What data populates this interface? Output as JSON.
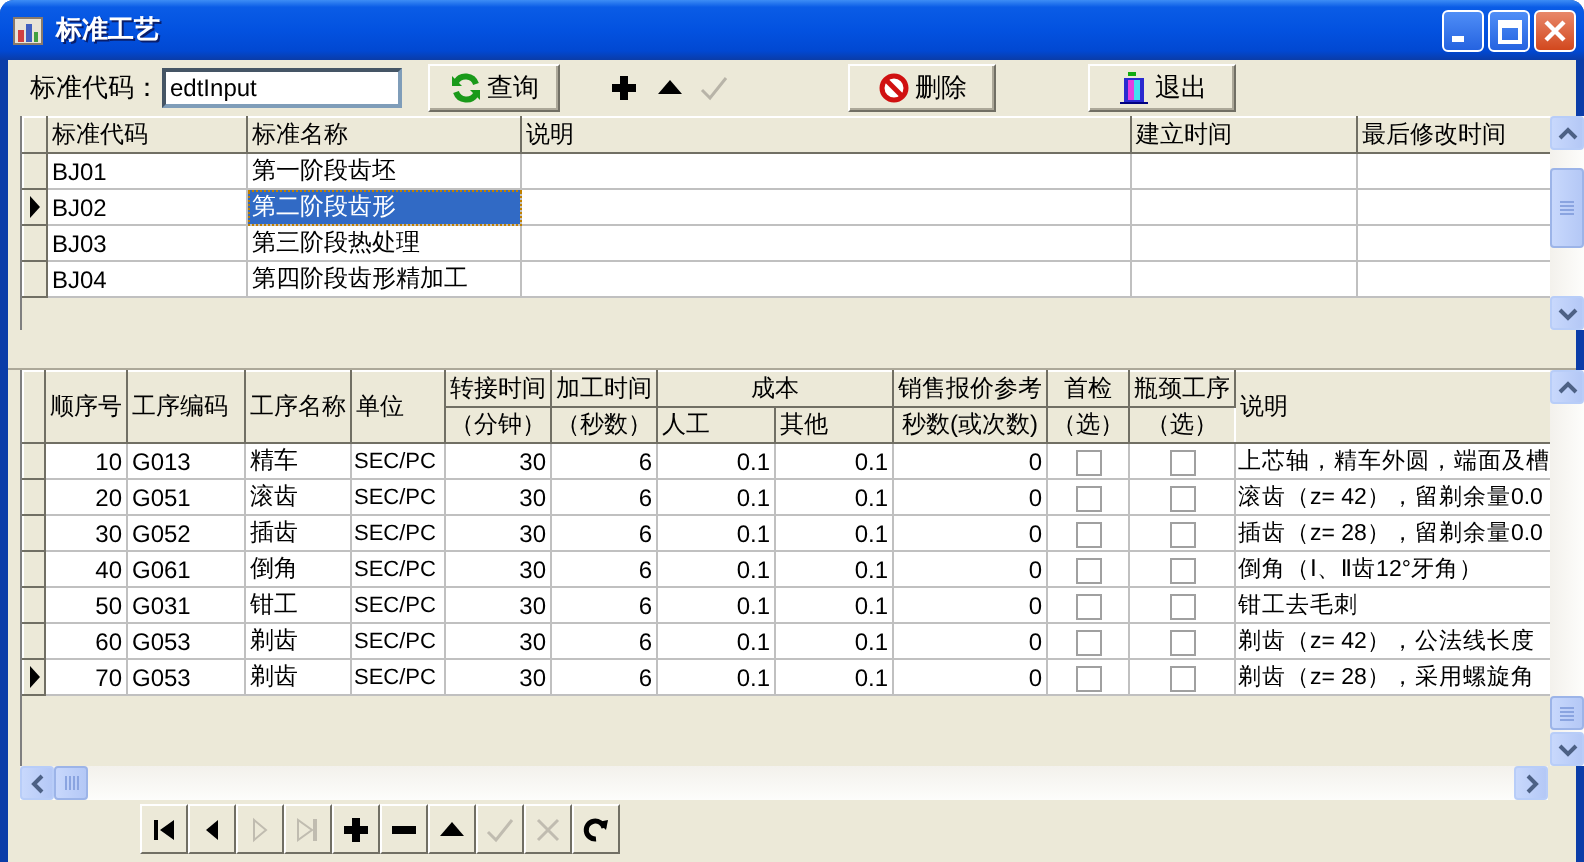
{
  "window": {
    "title": "标准工艺"
  },
  "toolbar": {
    "code_label": "标准代码：",
    "code_input": {
      "value": "edtInput"
    },
    "buttons": [
      {
        "kind": "query",
        "label": "查询",
        "disabled": false
      },
      {
        "kind": "add",
        "disabled": false
      },
      {
        "kind": "edit",
        "disabled": false
      },
      {
        "kind": "post",
        "disabled": true
      },
      {
        "kind": "delete",
        "label": "删除",
        "disabled": false
      },
      {
        "kind": "exit",
        "label": "退出",
        "disabled": false
      }
    ]
  },
  "standards_grid": {
    "columns": [
      "标准代码",
      "标准名称",
      "说明",
      "建立时间",
      "最后修改时间"
    ],
    "rows": [
      {
        "code": "BJ01",
        "name": "第一阶段齿坯",
        "selected": false
      },
      {
        "code": "BJ02",
        "name": "第二阶段齿形",
        "selected": true
      },
      {
        "code": "BJ03",
        "name": "第三阶段热处理",
        "selected": false
      },
      {
        "code": "BJ04",
        "name": "第四阶段齿形精加工",
        "selected": false
      }
    ]
  },
  "process_grid": {
    "columns": [
      {
        "label": "顺序号"
      },
      {
        "label": "工序编码"
      },
      {
        "label": "工序名称"
      },
      {
        "label": "单位"
      },
      {
        "label": "转接时间",
        "sub": "（分钟）"
      },
      {
        "label": "加工时间",
        "sub": "（秒数）"
      },
      {
        "group": "成本",
        "children": [
          "人工",
          "其他"
        ]
      },
      {
        "label": "销售报价参考",
        "sub": "秒数(或次数)"
      },
      {
        "label": "首检",
        "sub": "（选）"
      },
      {
        "label": "瓶颈工序",
        "sub": "（选）"
      },
      {
        "label": "说明"
      }
    ],
    "rows": [
      {
        "seq": "10",
        "code": "G013",
        "name": "精车",
        "unit": "SEC/PC",
        "transfer": "30",
        "process": "6",
        "labor": "0.1",
        "other": "0.1",
        "quote": "0",
        "first_check": false,
        "bottleneck": false,
        "note": "上芯轴，精车外圆，端面及槽",
        "selected": false
      },
      {
        "seq": "20",
        "code": "G051",
        "name": "滚齿",
        "unit": "SEC/PC",
        "transfer": "30",
        "process": "6",
        "labor": "0.1",
        "other": "0.1",
        "quote": "0",
        "first_check": false,
        "bottleneck": false,
        "note": "滚齿（z= 42），留剃余量0.0",
        "selected": false
      },
      {
        "seq": "30",
        "code": "G052",
        "name": "插齿",
        "unit": "SEC/PC",
        "transfer": "30",
        "process": "6",
        "labor": "0.1",
        "other": "0.1",
        "quote": "0",
        "first_check": false,
        "bottleneck": false,
        "note": "插齿（z= 28），留剃余量0.0",
        "selected": false
      },
      {
        "seq": "40",
        "code": "G061",
        "name": "倒角",
        "unit": "SEC/PC",
        "transfer": "30",
        "process": "6",
        "labor": "0.1",
        "other": "0.1",
        "quote": "0",
        "first_check": false,
        "bottleneck": false,
        "note": "倒角（Ⅰ、Ⅱ齿12°牙角）",
        "selected": false
      },
      {
        "seq": "50",
        "code": "G031",
        "name": "钳工",
        "unit": "SEC/PC",
        "transfer": "30",
        "process": "6",
        "labor": "0.1",
        "other": "0.1",
        "quote": "0",
        "first_check": false,
        "bottleneck": false,
        "note": "钳工去毛刺",
        "selected": false
      },
      {
        "seq": "60",
        "code": "G053",
        "name": "剃齿",
        "unit": "SEC/PC",
        "transfer": "30",
        "process": "6",
        "labor": "0.1",
        "other": "0.1",
        "quote": "0",
        "first_check": false,
        "bottleneck": false,
        "note": "剃齿（z= 42），公法线长度",
        "selected": false
      },
      {
        "seq": "70",
        "code": "G053",
        "name": "剃齿",
        "unit": "SEC/PC",
        "transfer": "30",
        "process": "6",
        "labor": "0.1",
        "other": "0.1",
        "quote": "0",
        "first_check": false,
        "bottleneck": false,
        "note": "剃齿（z= 28），采用螺旋角",
        "selected": true
      }
    ]
  },
  "navigator": [
    {
      "kind": "first",
      "disabled": false
    },
    {
      "kind": "prior",
      "disabled": false
    },
    {
      "kind": "next",
      "disabled": true
    },
    {
      "kind": "last",
      "disabled": true
    },
    {
      "kind": "insert",
      "disabled": false
    },
    {
      "kind": "delete",
      "disabled": false
    },
    {
      "kind": "edit",
      "disabled": false
    },
    {
      "kind": "post",
      "disabled": true
    },
    {
      "kind": "cancel",
      "disabled": true
    },
    {
      "kind": "refresh",
      "disabled": false
    }
  ]
}
